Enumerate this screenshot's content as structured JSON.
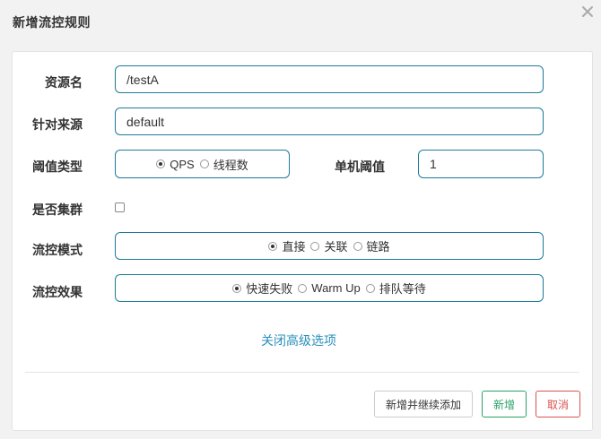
{
  "dialog": {
    "title": "新增流控规则"
  },
  "form": {
    "resource_name": {
      "label": "资源名",
      "value": "/testA"
    },
    "limit_app": {
      "label": "针对来源",
      "value": "default"
    },
    "threshold_type": {
      "label": "阈值类型",
      "options": [
        "QPS",
        "线程数"
      ],
      "selected": "QPS"
    },
    "single_threshold": {
      "label": "单机阈值",
      "value": "1"
    },
    "cluster": {
      "label": "是否集群",
      "checked": false
    },
    "flow_mode": {
      "label": "流控模式",
      "options": [
        "直接",
        "关联",
        "链路"
      ],
      "selected": "直接"
    },
    "flow_effect": {
      "label": "流控效果",
      "options": [
        "快速失败",
        "Warm Up",
        "排队等待"
      ],
      "selected": "快速失败"
    },
    "advanced_toggle": "关闭高级选项"
  },
  "footer": {
    "add_continue": "新增并继续添加",
    "add": "新增",
    "cancel": "取消"
  },
  "colors": {
    "input_border": "#1f7a9b",
    "link": "#2a8fbd",
    "success": "#2aa06a",
    "danger": "#d9534f"
  },
  "icons": {
    "close": "close-icon"
  }
}
